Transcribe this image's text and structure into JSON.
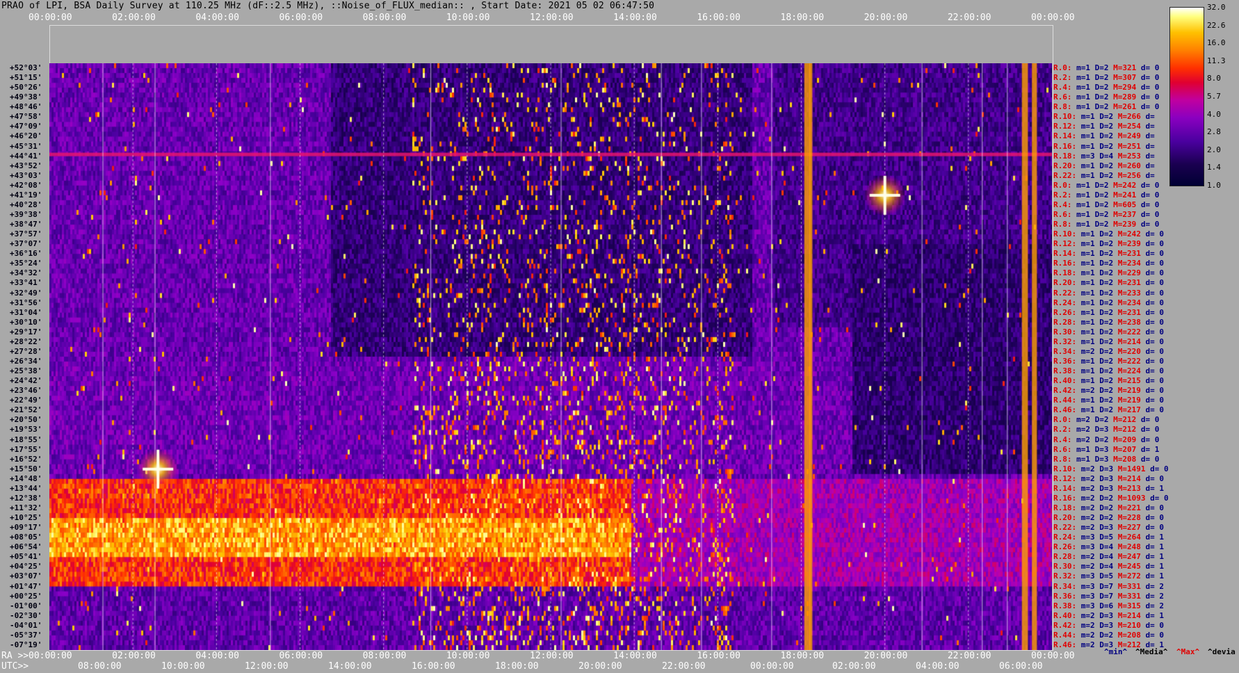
{
  "title": "PRAO of LPI, BSA Daily Survey at 110.25 MHz (dF::2.5 MHz), ::Noise_of_FLUX_median:: , Start Date: 2021 05 02 06:47:50",
  "chart_data": {
    "type": "heatmap",
    "top_axis_ticks": [
      "00:00:00",
      "02:00:00",
      "04:00:00",
      "06:00:00",
      "08:00:00",
      "10:00:00",
      "12:00:00",
      "14:00:00",
      "16:00:00",
      "18:00:00",
      "20:00:00",
      "22:00:00",
      "00:00:00"
    ],
    "ra_axis_label": "RA >>",
    "ra_axis_ticks": [
      "00:00:00",
      "02:00:00",
      "04:00:00",
      "06:00:00",
      "08:00:00",
      "10:00:00",
      "12:00:00",
      "14:00:00",
      "16:00:00",
      "18:00:00",
      "20:00:00",
      "22:00:00",
      "00:00:00"
    ],
    "utc_axis_label": "UTC>>",
    "utc_axis_ticks": [
      "08:00:00",
      "10:00:00",
      "12:00:00",
      "14:00:00",
      "16:00:00",
      "18:00:00",
      "20:00:00",
      "22:00:00",
      "00:00:00",
      "02:00:00",
      "04:00:00",
      "06:00:00"
    ],
    "declinations": [
      "+52°03'",
      "+51°15'",
      "+50°26'",
      "+49°38'",
      "+48°46'",
      "+47°58'",
      "+47°09'",
      "+46°20'",
      "+45°31'",
      "+44°41'",
      "+43°52'",
      "+43°03'",
      "+42°08'",
      "+41°19'",
      "+40°28'",
      "+39°38'",
      "+38°47'",
      "+37°57'",
      "+37°07'",
      "+36°16'",
      "+35°24'",
      "+34°32'",
      "+33°41'",
      "+32°49'",
      "+31°56'",
      "+31°04'",
      "+30°10'",
      "+29°17'",
      "+28°22'",
      "+27°28'",
      "+26°34'",
      "+25°38'",
      "+24°42'",
      "+23°46'",
      "+22°49'",
      "+21°52'",
      "+20°50'",
      "+19°53'",
      "+18°55'",
      "+17°55'",
      "+16°52'",
      "+15°50'",
      "+14°48'",
      "+13°44'",
      "+12°38'",
      "+11°32'",
      "+10°25'",
      "+09°17'",
      "+08°05'",
      "+06°54'",
      "+05°41'",
      "+04°25'",
      "+03°07'",
      "+01°47'",
      "+00°25'",
      "-01°00'",
      "-02°30'",
      "-04°01'",
      "-05°37'",
      "-07°19'"
    ],
    "row_stats": [
      {
        "r": "R.0:",
        "m": "m=1",
        "d": "D=2",
        "M": "M=321",
        "dd": "d= 0"
      },
      {
        "r": "R.2:",
        "m": "m=1",
        "d": "D=2",
        "M": "M=307",
        "dd": "d= 0"
      },
      {
        "r": "R.4:",
        "m": "m=1",
        "d": "D=2",
        "M": "M=294",
        "dd": "d= 0"
      },
      {
        "r": "R.6:",
        "m": "m=1",
        "d": "D=2",
        "M": "M=289",
        "dd": "d= 0"
      },
      {
        "r": "R.8:",
        "m": "m=1",
        "d": "D=2",
        "M": "M=261",
        "dd": "d= 0"
      },
      {
        "r": "R.10:",
        "m": "m=1",
        "d": "D=2",
        "M": "M=266",
        "dd": "d="
      },
      {
        "r": "R.12:",
        "m": "m=1",
        "d": "D=2",
        "M": "M=254",
        "dd": "d="
      },
      {
        "r": "R.14:",
        "m": "m=1",
        "d": "D=2",
        "M": "M=249",
        "dd": "d="
      },
      {
        "r": "R.16:",
        "m": "m=1",
        "d": "D=2",
        "M": "M=251",
        "dd": "d="
      },
      {
        "r": "R.18:",
        "m": "m=3",
        "d": "D=4",
        "M": "M=253",
        "dd": "d="
      },
      {
        "r": "R.20:",
        "m": "m=1",
        "d": "D=2",
        "M": "M=260",
        "dd": "d="
      },
      {
        "r": "R.22:",
        "m": "m=1",
        "d": "D=2",
        "M": "M=256",
        "dd": "d="
      },
      {
        "r": "R.0:",
        "m": "m=1",
        "d": "D=2",
        "M": "M=242",
        "dd": "d= 0"
      },
      {
        "r": "R.2:",
        "m": "m=1",
        "d": "D=2",
        "M": "M=241",
        "dd": "d= 0"
      },
      {
        "r": "R.4:",
        "m": "m=1",
        "d": "D=2",
        "M": "M=605",
        "dd": "d= 0"
      },
      {
        "r": "R.6:",
        "m": "m=1",
        "d": "D=2",
        "M": "M=237",
        "dd": "d= 0"
      },
      {
        "r": "R.8:",
        "m": "m=1",
        "d": "D=2",
        "M": "M=239",
        "dd": "d= 0"
      },
      {
        "r": "R.10:",
        "m": "m=1",
        "d": "D=2",
        "M": "M=242",
        "dd": "d= 0"
      },
      {
        "r": "R.12:",
        "m": "m=1",
        "d": "D=2",
        "M": "M=239",
        "dd": "d= 0"
      },
      {
        "r": "R.14:",
        "m": "m=1",
        "d": "D=2",
        "M": "M=231",
        "dd": "d= 0"
      },
      {
        "r": "R.16:",
        "m": "m=1",
        "d": "D=2",
        "M": "M=234",
        "dd": "d= 0"
      },
      {
        "r": "R.18:",
        "m": "m=1",
        "d": "D=2",
        "M": "M=229",
        "dd": "d= 0"
      },
      {
        "r": "R.20:",
        "m": "m=1",
        "d": "D=2",
        "M": "M=231",
        "dd": "d= 0"
      },
      {
        "r": "R.22:",
        "m": "m=1",
        "d": "D=2",
        "M": "M=233",
        "dd": "d= 0"
      },
      {
        "r": "R.24:",
        "m": "m=1",
        "d": "D=2",
        "M": "M=234",
        "dd": "d= 0"
      },
      {
        "r": "R.26:",
        "m": "m=1",
        "d": "D=2",
        "M": "M=231",
        "dd": "d= 0"
      },
      {
        "r": "R.28:",
        "m": "m=1",
        "d": "D=2",
        "M": "M=238",
        "dd": "d= 0"
      },
      {
        "r": "R.30:",
        "m": "m=1",
        "d": "D=2",
        "M": "M=222",
        "dd": "d= 0"
      },
      {
        "r": "R.32:",
        "m": "m=1",
        "d": "D=2",
        "M": "M=214",
        "dd": "d= 0"
      },
      {
        "r": "R.34:",
        "m": "m=2",
        "d": "D=2",
        "M": "M=220",
        "dd": "d= 0"
      },
      {
        "r": "R.36:",
        "m": "m=1",
        "d": "D=2",
        "M": "M=222",
        "dd": "d= 0"
      },
      {
        "r": "R.38:",
        "m": "m=1",
        "d": "D=2",
        "M": "M=224",
        "dd": "d= 0"
      },
      {
        "r": "R.40:",
        "m": "m=1",
        "d": "D=2",
        "M": "M=215",
        "dd": "d= 0"
      },
      {
        "r": "R.42:",
        "m": "m=2",
        "d": "D=2",
        "M": "M=219",
        "dd": "d= 0"
      },
      {
        "r": "R.44:",
        "m": "m=1",
        "d": "D=2",
        "M": "M=219",
        "dd": "d= 0"
      },
      {
        "r": "R.46:",
        "m": "m=1",
        "d": "D=2",
        "M": "M=217",
        "dd": "d= 0"
      },
      {
        "r": "R.0:",
        "m": "m=2",
        "d": "D=2",
        "M": "M=212",
        "dd": "d= 0"
      },
      {
        "r": "R.2:",
        "m": "m=2",
        "d": "D=3",
        "M": "M=212",
        "dd": "d= 0"
      },
      {
        "r": "R.4:",
        "m": "m=2",
        "d": "D=2",
        "M": "M=209",
        "dd": "d= 0"
      },
      {
        "r": "R.6:",
        "m": "m=1",
        "d": "D=3",
        "M": "M=207",
        "dd": "d= 1"
      },
      {
        "r": "R.8:",
        "m": "m=1",
        "d": "D=3",
        "M": "M=208",
        "dd": "d= 0"
      },
      {
        "r": "R.10:",
        "m": "m=2",
        "d": "D=3",
        "M": "M=1491",
        "dd": "d= 0"
      },
      {
        "r": "R.12:",
        "m": "m=2",
        "d": "D=3",
        "M": "M=214",
        "dd": "d= 0"
      },
      {
        "r": "R.14:",
        "m": "m=2",
        "d": "D=3",
        "M": "M=213",
        "dd": "d= 1"
      },
      {
        "r": "R.16:",
        "m": "m=2",
        "d": "D=2",
        "M": "M=1093",
        "dd": "d= 0"
      },
      {
        "r": "R.18:",
        "m": "m=2",
        "d": "D=2",
        "M": "M=221",
        "dd": "d= 0"
      },
      {
        "r": "R.20:",
        "m": "m=2",
        "d": "D=2",
        "M": "M=228",
        "dd": "d= 0"
      },
      {
        "r": "R.22:",
        "m": "m=2",
        "d": "D=3",
        "M": "M=227",
        "dd": "d= 0"
      },
      {
        "r": "R.24:",
        "m": "m=3",
        "d": "D=5",
        "M": "M=264",
        "dd": "d= 1"
      },
      {
        "r": "R.26:",
        "m": "m=3",
        "d": "D=4",
        "M": "M=248",
        "dd": "d= 1"
      },
      {
        "r": "R.28:",
        "m": "m=2",
        "d": "D=4",
        "M": "M=247",
        "dd": "d= 1"
      },
      {
        "r": "R.30:",
        "m": "m=2",
        "d": "D=4",
        "M": "M=245",
        "dd": "d= 1"
      },
      {
        "r": "R.32:",
        "m": "m=3",
        "d": "D=5",
        "M": "M=272",
        "dd": "d= 1"
      },
      {
        "r": "R.34:",
        "m": "m=3",
        "d": "D=7",
        "M": "M=331",
        "dd": "d= 2"
      },
      {
        "r": "R.36:",
        "m": "m=3",
        "d": "D=7",
        "M": "M=331",
        "dd": "d= 2"
      },
      {
        "r": "R.38:",
        "m": "m=3",
        "d": "D=6",
        "M": "M=315",
        "dd": "d= 2"
      },
      {
        "r": "R.40:",
        "m": "m=2",
        "d": "D=3",
        "M": "M=214",
        "dd": "d= 1"
      },
      {
        "r": "R.42:",
        "m": "m=2",
        "d": "D=3",
        "M": "M=210",
        "dd": "d= 0"
      },
      {
        "r": "R.44:",
        "m": "m=2",
        "d": "D=2",
        "M": "M=208",
        "dd": "d= 0"
      },
      {
        "r": "R.46:",
        "m": "m=2",
        "d": "D=3",
        "M": "M=212",
        "dd": "d= 1"
      }
    ],
    "colorbar_ticks": [
      "32.0",
      "22.6",
      "16.0",
      "11.3",
      "8.0",
      "5.7",
      "4.0",
      "2.8",
      "2.0",
      "1.4",
      "1.0"
    ],
    "legend": [
      "^min^",
      "^Media^",
      "^Max^",
      "^devia"
    ],
    "bright_sources": [
      {
        "ra_hours": 20.0,
        "dec": "+41°19'"
      },
      {
        "ra_hours": 2.6,
        "dec": "+15°50'"
      }
    ]
  }
}
